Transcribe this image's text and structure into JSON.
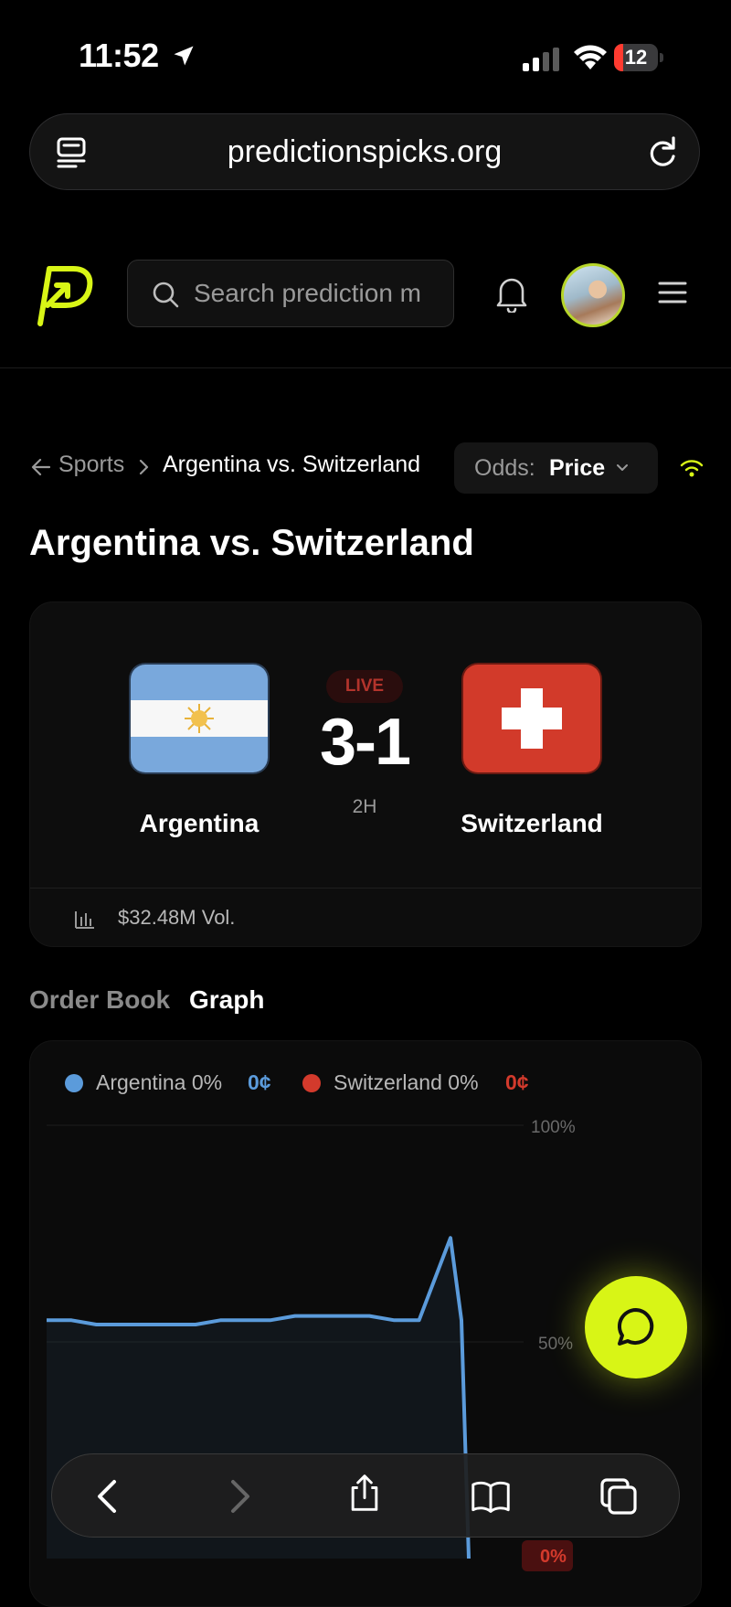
{
  "status_bar": {
    "time": "11:52",
    "battery": "12"
  },
  "browser": {
    "url": "predictionspicks.org"
  },
  "header": {
    "search_placeholder": "Search prediction m"
  },
  "breadcrumb": {
    "parent": "Sports",
    "current": "Argentina vs. Switzerland"
  },
  "odds": {
    "label": "Odds:",
    "value": "Price"
  },
  "page": {
    "title": "Argentina vs. Switzerland"
  },
  "match": {
    "home": "Argentina",
    "away": "Switzerland",
    "status": "LIVE",
    "score": "3-1",
    "period": "2H",
    "volume": "$32.48M Vol."
  },
  "tabs": {
    "order_book": "Order Book",
    "graph": "Graph"
  },
  "graph": {
    "legend": [
      {
        "name": "Argentina 0%",
        "price": "0¢",
        "color": "#5b9bdb"
      },
      {
        "name": "Switzerland 0%",
        "price": "0¢",
        "color": "#d33a2c"
      }
    ],
    "y_ticks": [
      "100%",
      "50%",
      "0%"
    ]
  },
  "chart_data": {
    "type": "line",
    "series": [
      {
        "name": "Argentina",
        "values": [
          55,
          55,
          54,
          54,
          54,
          54,
          54,
          55,
          55,
          55,
          56,
          56,
          56,
          56,
          55,
          55,
          74,
          55,
          0
        ]
      }
    ],
    "ylim": [
      0,
      100
    ]
  },
  "colors": {
    "accent": "#d8f516",
    "argentina": "#5b9bdb",
    "switzerland": "#d33a2c"
  }
}
